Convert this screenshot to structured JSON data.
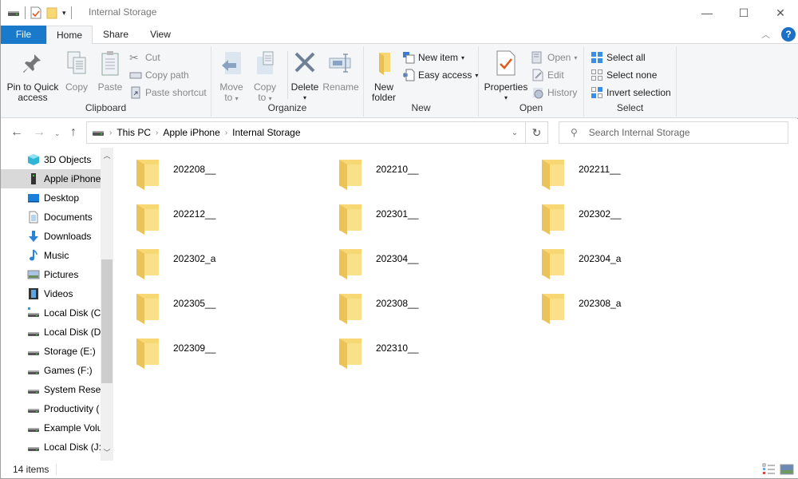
{
  "window": {
    "title": "Internal Storage",
    "controls": {
      "minimize": "—",
      "maximize": "☐",
      "close": "✕"
    }
  },
  "ribbon": {
    "tabs": [
      {
        "label": "File"
      },
      {
        "label": "Home"
      },
      {
        "label": "Share"
      },
      {
        "label": "View"
      }
    ],
    "active_tab": "Home",
    "groups": {
      "clipboard": {
        "label": "Clipboard",
        "pin": "Pin to Quick access",
        "pin_line1": "Pin to Quick",
        "pin_line2": "access",
        "copy": "Copy",
        "paste": "Paste",
        "cut": "Cut",
        "copy_path": "Copy path",
        "paste_shortcut": "Paste shortcut"
      },
      "organize": {
        "label": "Organize",
        "move_to_1": "Move",
        "move_to_2": "to",
        "copy_to_1": "Copy",
        "copy_to_2": "to",
        "delete": "Delete",
        "rename": "Rename"
      },
      "new": {
        "label": "New",
        "new_folder_1": "New",
        "new_folder_2": "folder",
        "new_item": "New item",
        "easy_access": "Easy access"
      },
      "open": {
        "label": "Open",
        "properties": "Properties",
        "open": "Open",
        "edit": "Edit",
        "history": "History"
      },
      "select": {
        "label": "Select",
        "select_all": "Select all",
        "select_none": "Select none",
        "invert_selection": "Invert selection"
      }
    },
    "help": "?"
  },
  "nav": {
    "breadcrumb": [
      "This PC",
      "Apple iPhone",
      "Internal Storage"
    ],
    "search_placeholder": "Search Internal Storage"
  },
  "navpane": {
    "items": [
      {
        "label": "3D Objects",
        "icon": "3d-objects-icon"
      },
      {
        "label": "Apple iPhone",
        "icon": "iphone-icon",
        "selected": true
      },
      {
        "label": "Desktop",
        "icon": "desktop-icon"
      },
      {
        "label": "Documents",
        "icon": "documents-icon"
      },
      {
        "label": "Downloads",
        "icon": "downloads-icon"
      },
      {
        "label": "Music",
        "icon": "music-icon"
      },
      {
        "label": "Pictures",
        "icon": "pictures-icon"
      },
      {
        "label": "Videos",
        "icon": "videos-icon"
      },
      {
        "label": "Local Disk (C:",
        "icon": "system-drive-icon"
      },
      {
        "label": "Local Disk (D:",
        "icon": "drive-icon"
      },
      {
        "label": "Storage (E:)",
        "icon": "drive-icon"
      },
      {
        "label": "Games (F:)",
        "icon": "drive-icon"
      },
      {
        "label": "System Reser",
        "icon": "drive-icon"
      },
      {
        "label": "Productivity (",
        "icon": "drive-icon"
      },
      {
        "label": "Example Volu",
        "icon": "drive-icon"
      },
      {
        "label": "Local Disk (J:)",
        "icon": "drive-icon"
      }
    ]
  },
  "content": {
    "folders": [
      "202208__",
      "202210__",
      "202211__",
      "202212__",
      "202301__",
      "202302__",
      "202302_a",
      "202304__",
      "202304_a",
      "202305__",
      "202308__",
      "202308_a",
      "202309__",
      "202310__"
    ]
  },
  "status": {
    "item_count": "14 items"
  },
  "colors": {
    "accent": "#1979ca",
    "folder": "#f8d775",
    "selected_nav": "#d9d9d9"
  }
}
